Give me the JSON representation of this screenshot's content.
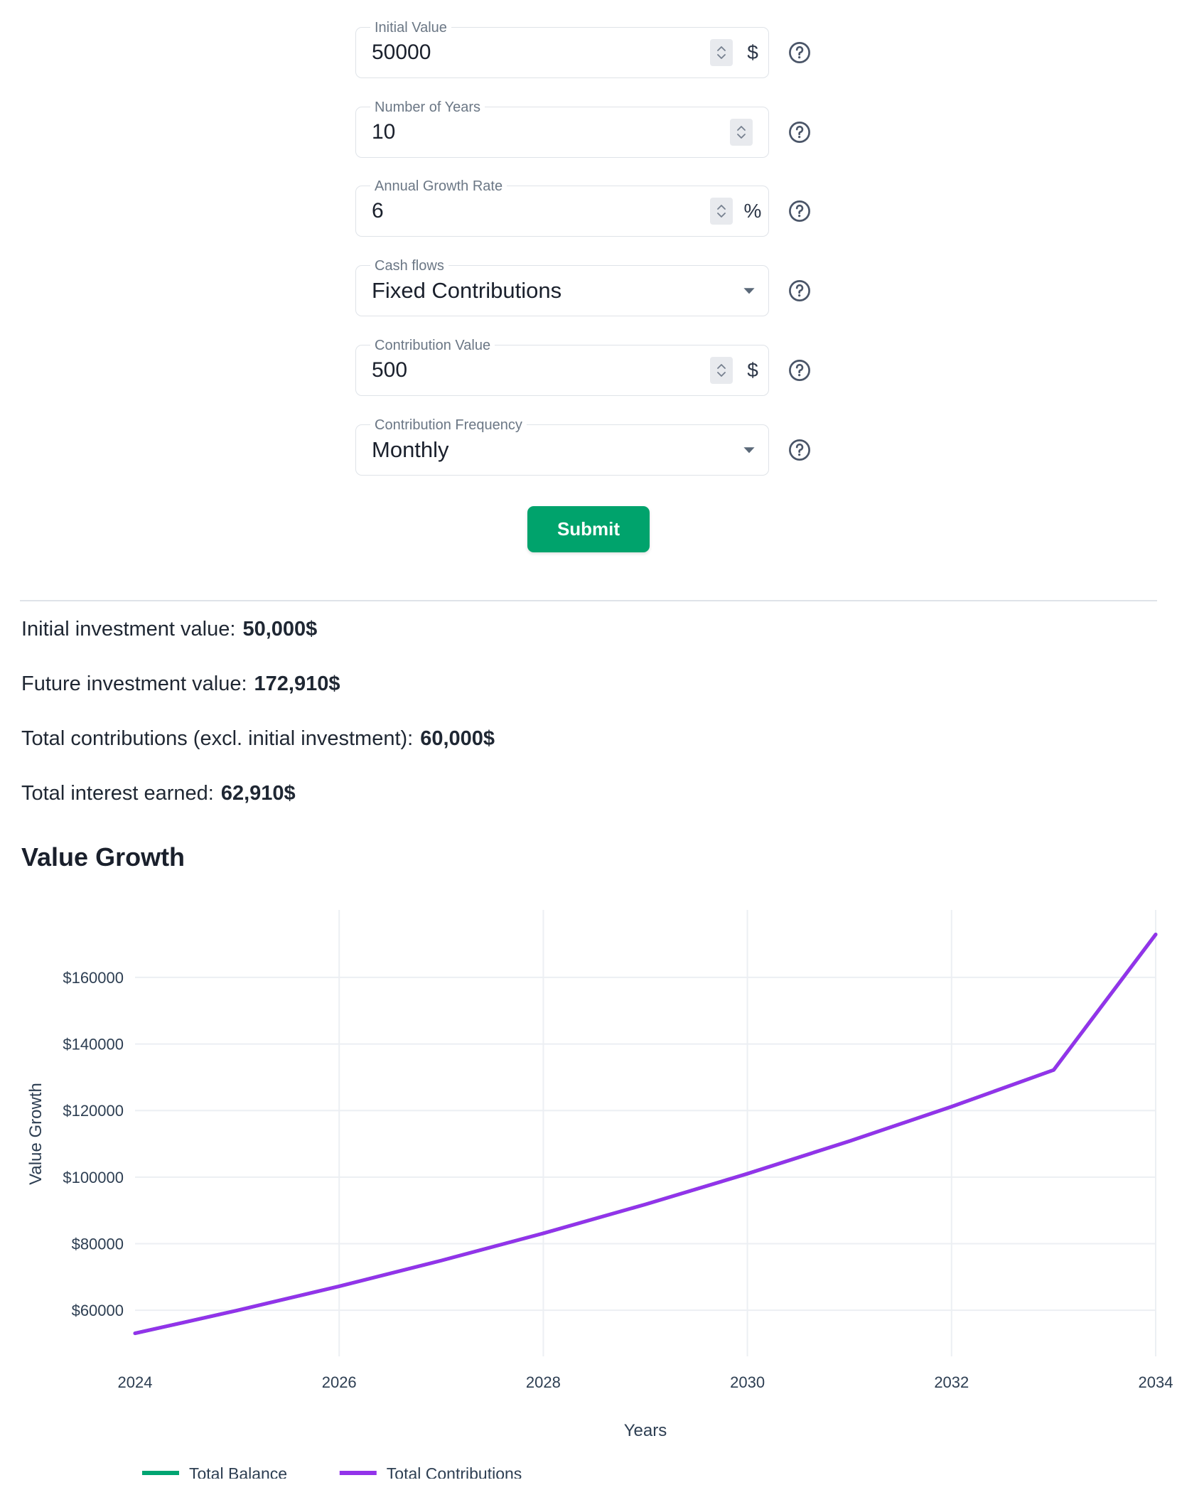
{
  "form": {
    "fields": [
      {
        "label": "Initial Value",
        "value": "50000",
        "unit": "$",
        "type": "number",
        "spinner": true,
        "help": "help-icon"
      },
      {
        "label": "Number of Years",
        "value": "10",
        "unit": "",
        "type": "number",
        "spinner": true,
        "help": "help-icon"
      },
      {
        "label": "Annual Growth Rate",
        "value": "6",
        "unit": "%",
        "type": "number",
        "spinner": true,
        "help": "help-icon"
      },
      {
        "label": "Cash flows",
        "value": "Fixed Contributions",
        "unit": "",
        "type": "select",
        "spinner": false,
        "help": "help-icon"
      },
      {
        "label": "Contribution Value",
        "value": "500",
        "unit": "$",
        "type": "number",
        "spinner": true,
        "help": "help-icon"
      },
      {
        "label": "Contribution Frequency",
        "value": "Monthly",
        "unit": "",
        "type": "select",
        "spinner": false,
        "help": "help-icon"
      }
    ],
    "submit_label": "Submit",
    "submit_color": "#00a36c"
  },
  "results": [
    {
      "label": "Initial investment value:",
      "value": "50,000$"
    },
    {
      "label": "Future investment value:",
      "value": "172,910$"
    },
    {
      "label": "Total contributions (excl. initial investment):",
      "value": "60,000$"
    },
    {
      "label": "Total interest earned:",
      "value": "62,910$"
    }
  ],
  "section_title": "Value Growth",
  "chart_data": {
    "type": "line",
    "title": "",
    "xlabel": "Years",
    "ylabel": "Value Growth",
    "grid": true,
    "legend_position": "bottom-left",
    "x": [
      2024,
      2025,
      2026,
      2027,
      2028,
      2029,
      2030,
      2031,
      2032,
      2033,
      2034
    ],
    "xticks": [
      2024,
      2026,
      2028,
      2030,
      2032,
      2034
    ],
    "xtick_labels": [
      "2024",
      "2026",
      "2028",
      "2030",
      "2032",
      "2034"
    ],
    "yticks": [
      60000,
      80000,
      100000,
      120000,
      140000,
      160000
    ],
    "ytick_labels": [
      "$60000",
      "$80000",
      "$100000",
      "$120000",
      "$140000",
      "$160000"
    ],
    "ylim": [
      50000,
      176000
    ],
    "xlim": [
      2024,
      2034
    ],
    "series": [
      {
        "name": "Total Balance",
        "color": "#00a572",
        "values": [
          53084,
          59939,
          67213,
          74931,
          83120,
          91808,
          101025,
          110803,
          121175,
          132178,
          172910
        ]
      },
      {
        "name": "Total Contributions",
        "color": "#9333ea",
        "values": [
          53084,
          59939,
          67213,
          74931,
          83120,
          91808,
          101025,
          110803,
          121175,
          132178,
          172910
        ]
      }
    ]
  }
}
